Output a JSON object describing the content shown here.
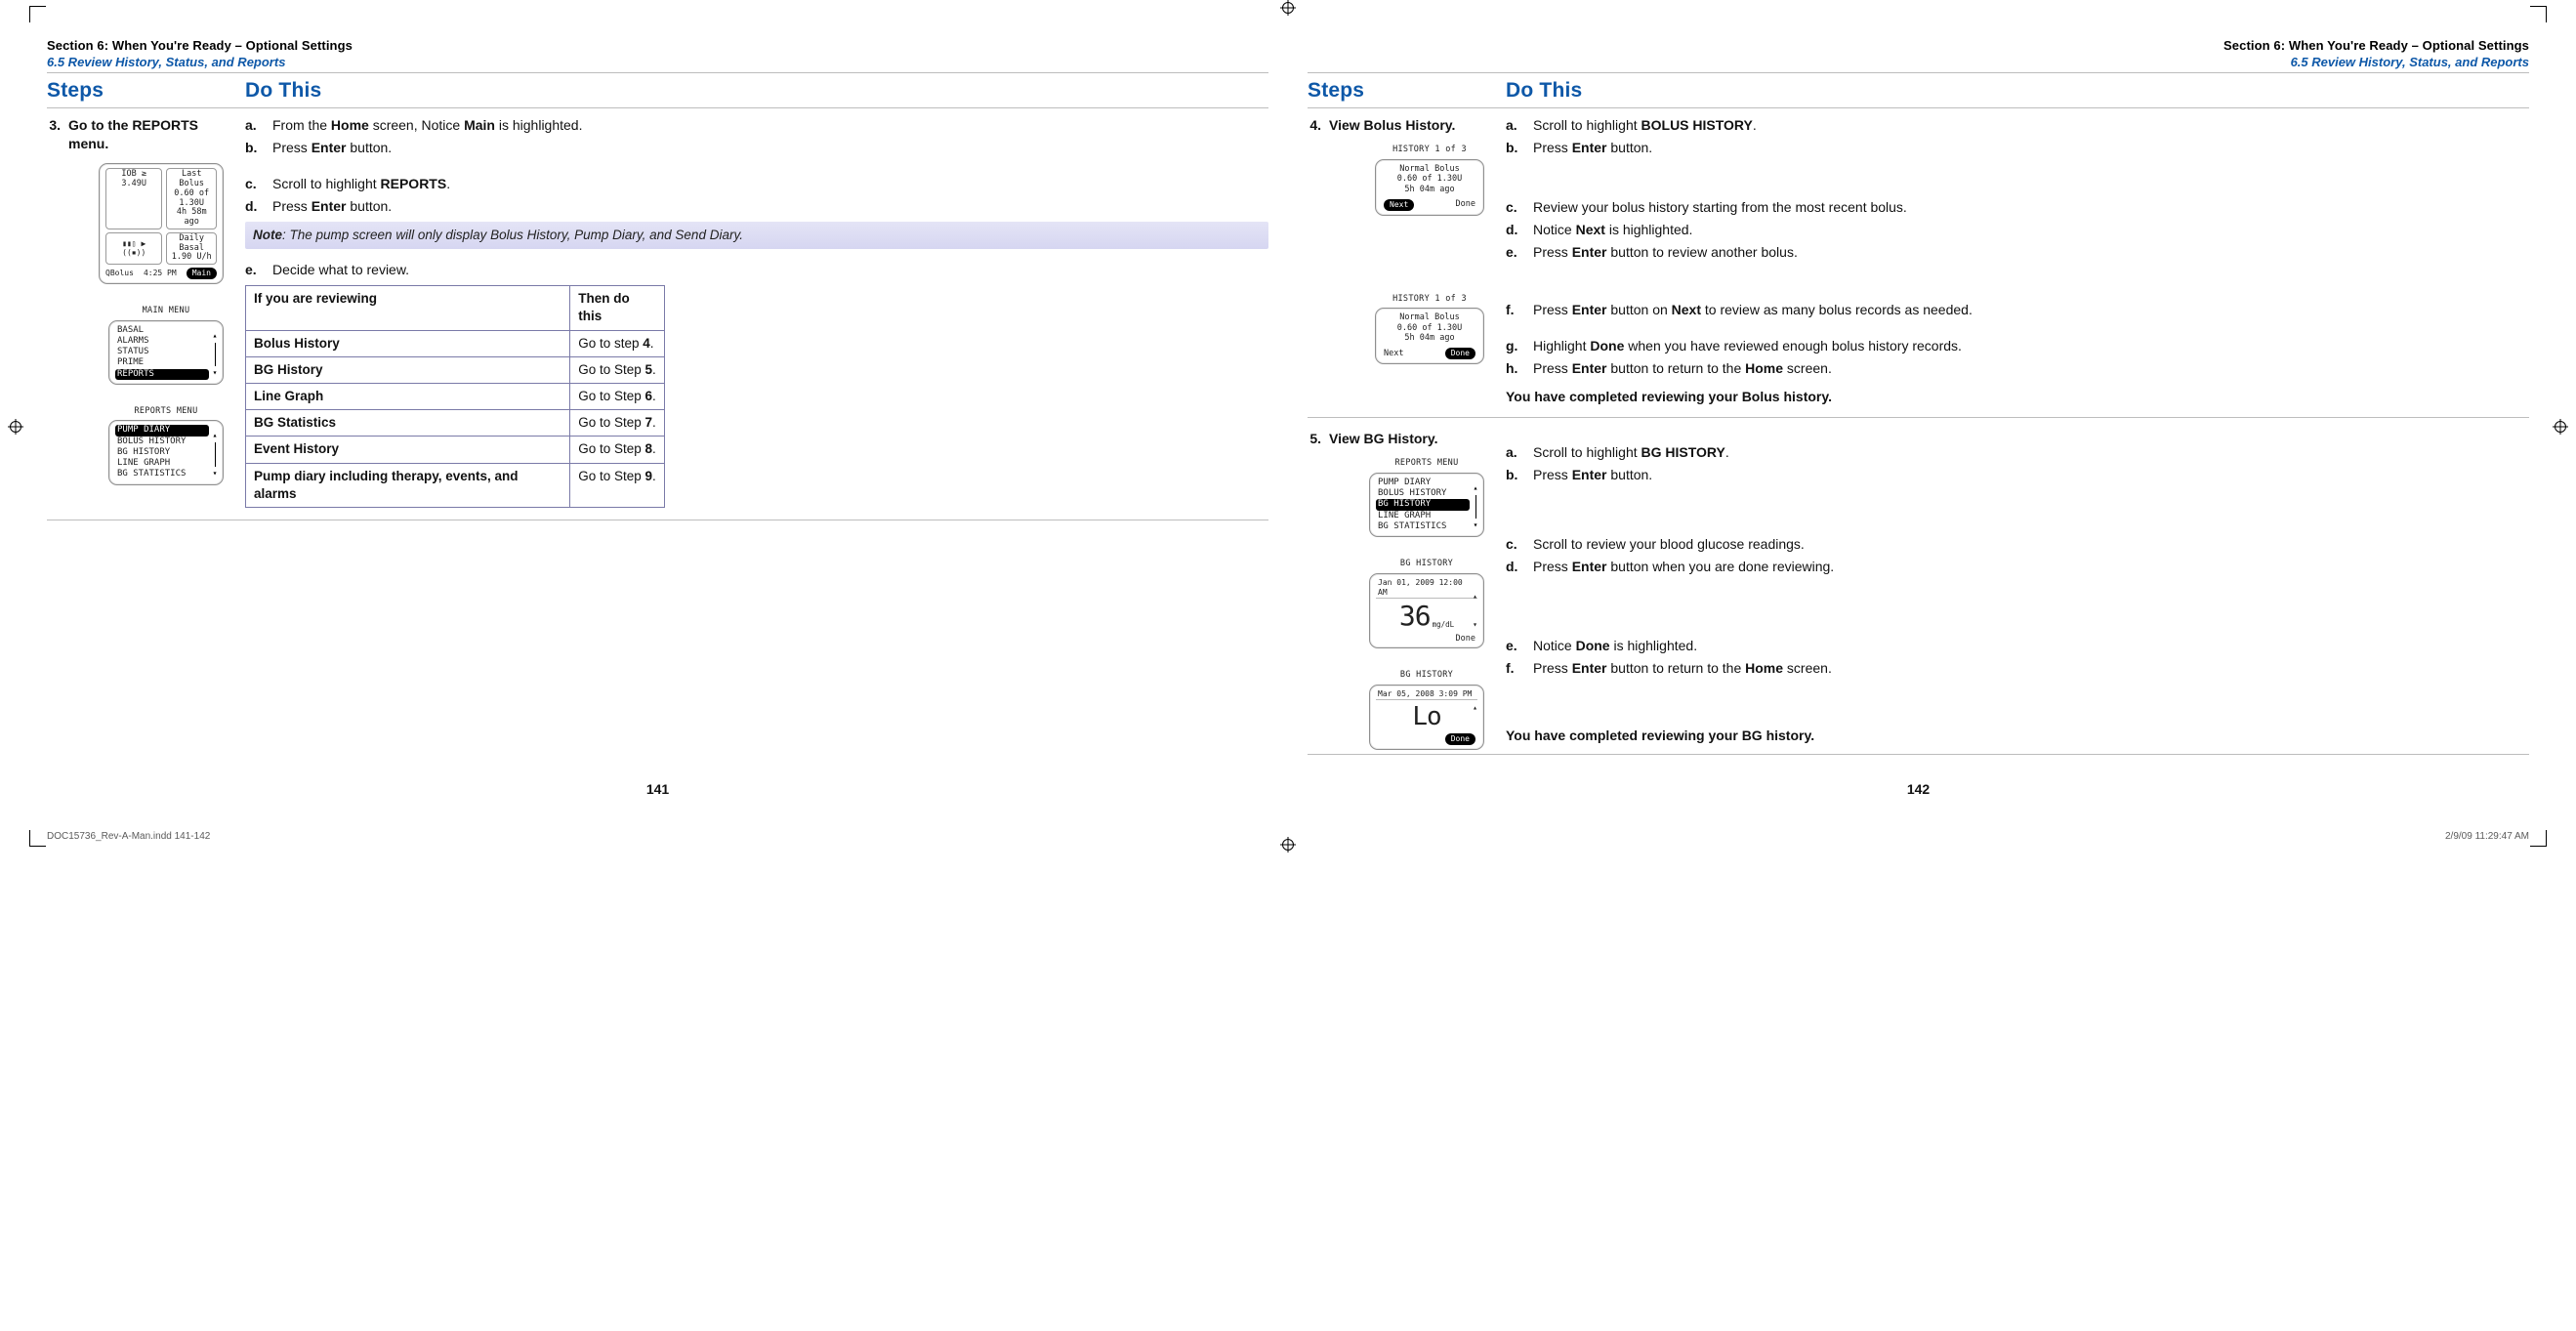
{
  "header": {
    "section": "Section 6: When You're Ready – Optional Settings",
    "subsection": "6.5 Review History, Status, and Reports"
  },
  "columns": {
    "steps": "Steps",
    "dothis": "Do This"
  },
  "left": {
    "step_num": "3.",
    "step_title": "Go to the REPORTS menu.",
    "substeps_a": [
      {
        "k": "a.",
        "html": "From the <b>Home</b> screen, Notice <b>Main</b> is highlighted."
      },
      {
        "k": "b.",
        "html": "Press <b>Enter</b> button."
      }
    ],
    "substeps_b": [
      {
        "k": "c.",
        "html": "Scroll to highlight <b>REPORTS</b>."
      },
      {
        "k": "d.",
        "html": "Press <b>Enter</b> button."
      }
    ],
    "note": "The pump screen will only display Bolus History, Pump Diary, and Send Diary.",
    "note_label": "Note",
    "substeps_c": [
      {
        "k": "e.",
        "html": "Decide what to review."
      }
    ],
    "table": {
      "headers": [
        "If you are reviewing",
        "Then do this"
      ],
      "rows": [
        [
          "Bolus History",
          "Go to step <b>4</b>."
        ],
        [
          "BG History",
          "Go to Step <b>5</b>."
        ],
        [
          "Line Graph",
          "Go to Step <b>6</b>."
        ],
        [
          "BG Statistics",
          "Go to Step <b>7</b>."
        ],
        [
          "Event History",
          "Go to Step <b>8</b>."
        ],
        [
          "Pump diary including therapy, events, and alarms",
          "Go to Step <b>9</b>."
        ]
      ]
    },
    "page_num": "141",
    "devices": {
      "home": {
        "iob_label": "IOB ≥",
        "iob_val": "3.49U",
        "lastbolus_label": "Last Bolus",
        "lastbolus_val": "0.60 of 1.30U",
        "lastbolus_time": "4h 58m ago",
        "basal_label": "Daily Basal",
        "basal_val": "1.90 U/h",
        "qbolus": "QBolus",
        "time": "4:25 PM",
        "main": "Main"
      },
      "mainmenu": {
        "title": "MAIN MENU",
        "items": [
          "BASAL",
          "ALARMS",
          "STATUS",
          "PRIME",
          "REPORTS"
        ],
        "selected": 4
      },
      "reportsmenu": {
        "title": "REPORTS MENU",
        "items": [
          "PUMP DIARY",
          "BOLUS HISTORY",
          "BG HISTORY",
          "LINE GRAPH",
          "BG STATISTICS"
        ],
        "selected": 0
      }
    }
  },
  "right": {
    "step4": {
      "num": "4.",
      "title": "View Bolus History.",
      "groupA": [
        {
          "k": "a.",
          "html": "Scroll to highlight <b>BOLUS HISTORY</b>."
        },
        {
          "k": "b.",
          "html": "Press <b>Enter</b> button."
        }
      ],
      "groupB": [
        {
          "k": "c.",
          "html": "Review your bolus history starting from the most recent bolus."
        },
        {
          "k": "d.",
          "html": "Notice <b>Next</b> is highlighted."
        },
        {
          "k": "e.",
          "html": "Press <b>Enter</b> button to review another bolus."
        }
      ],
      "groupC": [
        {
          "k": "f.",
          "html": "Press <b>Enter</b> button on <b>Next</b> to review as many bolus records as needed."
        }
      ],
      "groupD": [
        {
          "k": "g.",
          "html": "Highlight <b>Done</b> when you have reviewed enough bolus history records."
        },
        {
          "k": "h.",
          "html": "Press <b>Enter</b> button to return to the <b>Home</b> screen."
        }
      ],
      "completion": "You have completed reviewing your Bolus history.",
      "dev_hist": {
        "title": "HISTORY 1 of 3",
        "l1": "Normal Bolus",
        "l2": "0.60 of 1.30U",
        "l3": "5h 04m ago",
        "next": "Next",
        "done": "Done"
      }
    },
    "step5": {
      "num": "5.",
      "title": "View BG History.",
      "groupA": [
        {
          "k": "a.",
          "html": "Scroll to highlight <b>BG HISTORY</b>."
        },
        {
          "k": "b.",
          "html": "Press <b>Enter</b> button."
        }
      ],
      "groupB": [
        {
          "k": "c.",
          "html": "Scroll to review your blood glucose readings."
        },
        {
          "k": "d.",
          "html": "Press <b>Enter</b> button when you are done reviewing."
        }
      ],
      "groupC": [
        {
          "k": "e.",
          "html": "Notice <b>Done</b> is highlighted."
        },
        {
          "k": "f.",
          "html": "Press <b>Enter</b> button to return to the <b>Home</b> screen."
        }
      ],
      "completion": "You have completed reviewing your BG history.",
      "dev_reports": {
        "title": "REPORTS MENU",
        "items": [
          "PUMP DIARY",
          "BOLUS HISTORY",
          "BG HISTORY",
          "LINE GRAPH",
          "BG STATISTICS"
        ],
        "selected": 2
      },
      "dev_bg1": {
        "title": "BG HISTORY",
        "top": "Jan 01, 2009  12:00 AM",
        "value": "36",
        "unit": "mg/dL",
        "done": "Done",
        "done_selected": false
      },
      "dev_bg2": {
        "title": "BG HISTORY",
        "top": "Mar 05, 2008  3:09 PM",
        "value": "Lo",
        "unit": "",
        "done": "Done",
        "done_selected": true
      }
    },
    "page_num": "142"
  },
  "footer": {
    "left": "DOC15736_Rev-A-Man.indd   141-142",
    "right": "2/9/09   11:29:47 AM"
  }
}
